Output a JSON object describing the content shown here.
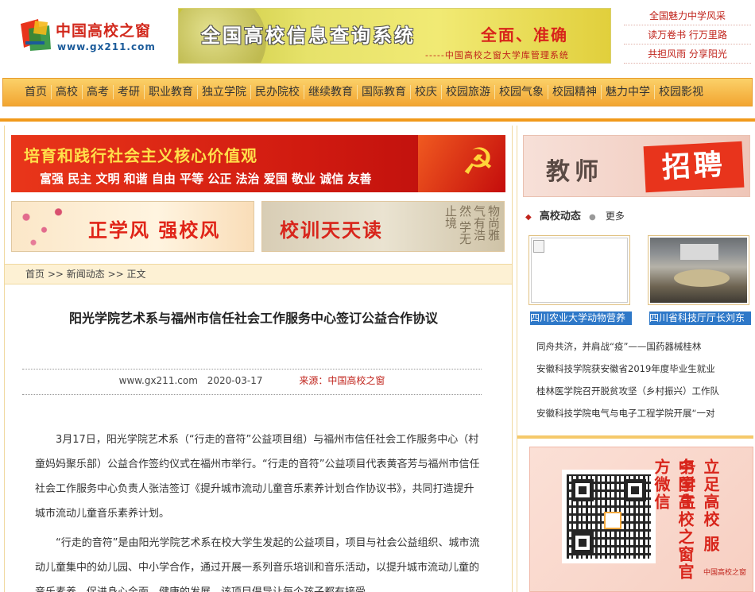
{
  "colors": {
    "accent": "#f19a1b",
    "red": "#c0231b",
    "link_blue": "#2e78c8"
  },
  "header": {
    "logo_cn": "中国高校之窗",
    "logo_url": "www.gx211.com",
    "banner_title": "全国高校信息查询系统",
    "banner_slogan": "全面、准确",
    "banner_sub": "-----中国高校之窗大学库管理系统",
    "top_links": [
      "全国魅力中学风采",
      "读万卷书 行万里路",
      "共担风雨 分享阳光"
    ]
  },
  "nav": [
    "首页",
    "高校",
    "高考",
    "考研",
    "职业教育",
    "独立学院",
    "民办院校",
    "继续教育",
    "国际教育",
    "校庆",
    "校园旅游",
    "校园气象",
    "校园精神",
    "魅力中学",
    "校园影视"
  ],
  "banners": {
    "values_title": "培育和践行社会主义核心价值观",
    "values_sub": "富强 民主 文明 和谐 自由 平等 公正 法治 爱国 敬业 诚信 友善",
    "style_title": "正学风 强校风",
    "motto_title": "校训天天读",
    "motto_calli": "物尚雅 气有浩然 学无止境"
  },
  "breadcrumb": "首页 >> 新闻动态 >> 正文",
  "article": {
    "title": "阳光学院艺术系与福州市信任社会工作服务中心签订公益合作协议",
    "site": "www.gx211.com",
    "date": "2020-03-17",
    "source": "来源：中国高校之窗",
    "paragraphs": [
      "3月17日，阳光学院艺术系（“行走的音符”公益项目组）与福州市信任社会工作服务中心（村童妈妈聚乐部）公益合作签约仪式在福州市举行。“行走的音符”公益项目代表黄吝芳与福州市信任社会工作服务中心负责人张洁签订《提升城市流动儿童音乐素养计划合作协议书》，共同打造提升城市流动儿童音乐素养计划。",
      "“行走的音符”是由阳光学院艺术系在校大学生发起的公益项目，项目与社会公益组织、城市流动儿童集中的幼儿园、中小学合作，通过开展一系列音乐培训和音乐活动，以提升城市流动儿童的音乐素养，促进身心全面、健康的发展。该项目倡导让每个孩子都有接受"
    ]
  },
  "sidebar": {
    "recruit_a": "教师",
    "recruit_b": "招聘",
    "section_name": "高校动态",
    "more_label": "更多",
    "thumb_captions": [
      "四川农业大学动物营养",
      "四川省科技厅厅长刘东"
    ],
    "news": [
      "同舟共济，并肩战“疫”——国药器械桂林",
      "安徽科技学院获安徽省2019年度毕业生就业",
      "桂林医学院召开脱贫攻坚（乡村振兴）工作队",
      "安徽科技学院电气与电子工程学院开展“一对"
    ],
    "qr_v1": "中国高校之窗官方微信",
    "qr_v2": "立足高校 服务学生",
    "qr_foot": "中国高校之窗"
  }
}
